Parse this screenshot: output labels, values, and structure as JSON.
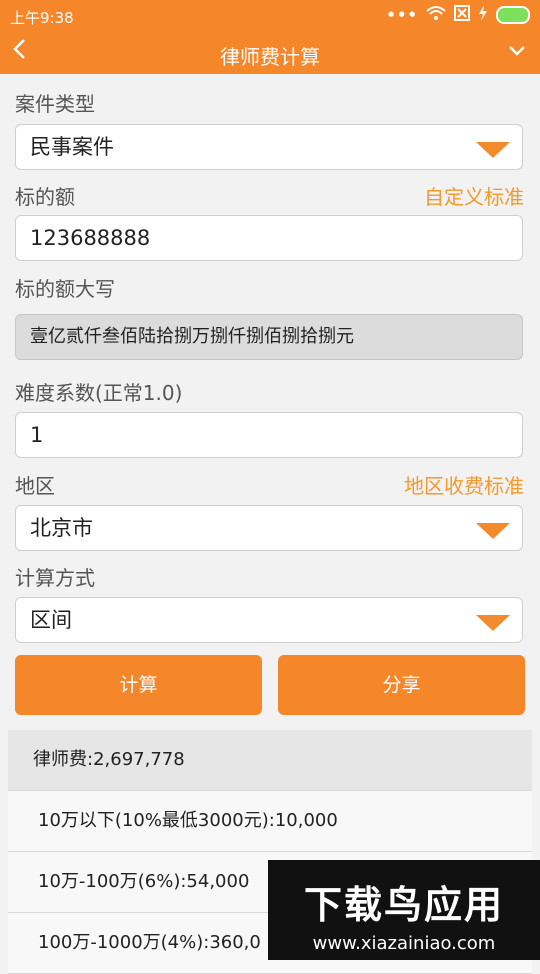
{
  "status": {
    "time": "上午9:38",
    "dots": "•••"
  },
  "header": {
    "title": "律师费计算",
    "back": "<"
  },
  "form": {
    "case_type_label": "案件类型",
    "case_type_value": "民事案件",
    "amount_label": "标的额",
    "custom_link": "自定义标准",
    "amount_value": "123688888",
    "amount_upper_label": "标的额大写",
    "amount_upper_value": "壹亿贰仟叁佰陆拾捌万捌仟捌佰捌拾捌元",
    "coef_label": "难度系数(正常1.0)",
    "coef_value": "1",
    "region_label": "地区",
    "region_link": "地区收费标准",
    "region_value": "北京市",
    "method_label": "计算方式",
    "method_value": "区间"
  },
  "buttons": {
    "calculate": "计算",
    "share": "分享"
  },
  "results": {
    "total": "律师费:2,697,778",
    "items": [
      "10万以下(10%最低3000元):10,000",
      "10万-100万(6%):54,000",
      "100万-1000万(4%):360,0"
    ]
  },
  "watermark": {
    "title": "下载鸟应用",
    "url": "www.xiazainiao.com"
  },
  "colors": {
    "accent": "#f6862a",
    "link": "#f39a2b"
  }
}
